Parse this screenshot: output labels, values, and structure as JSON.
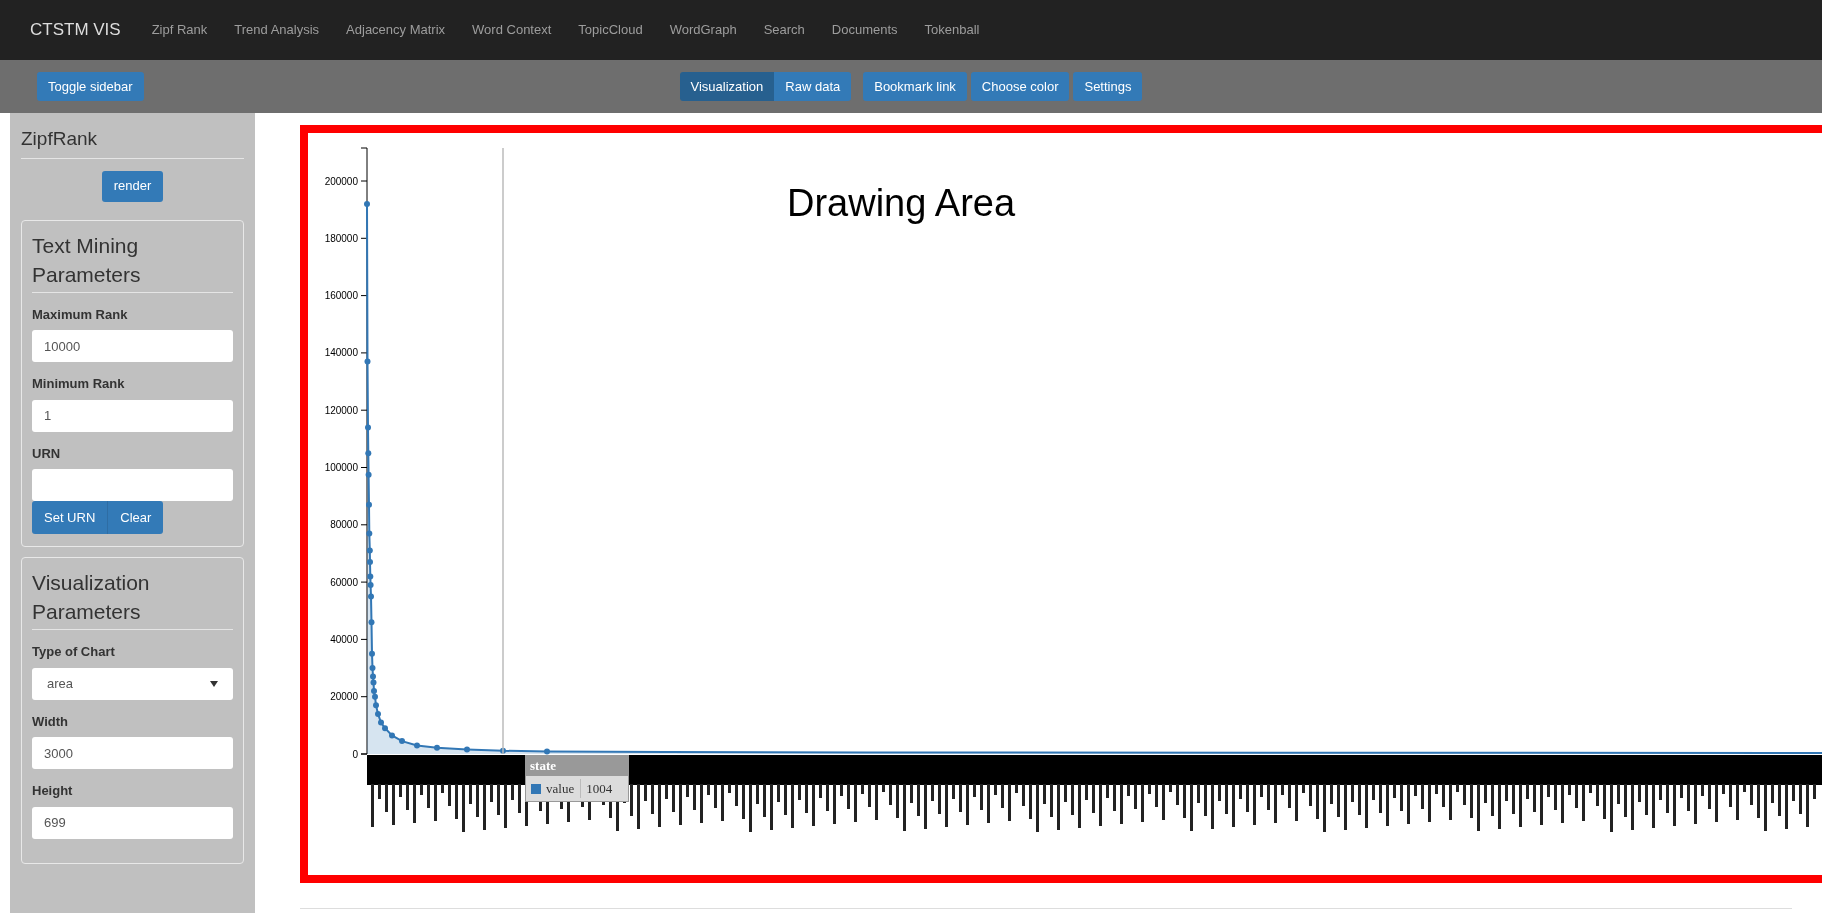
{
  "navbar": {
    "brand": "CTSTM VIS",
    "links": [
      "Zipf Rank",
      "Trend Analysis",
      "Adjacency Matrix",
      "Word Context",
      "TopicCloud",
      "WordGraph",
      "Search",
      "Documents",
      "Tokenball"
    ]
  },
  "toolbar": {
    "toggle": "Toggle sidebar",
    "view_tabs": [
      {
        "label": "Visualization",
        "selected": true
      },
      {
        "label": "Raw data",
        "selected": false
      }
    ],
    "buttons": [
      "Bookmark link",
      "Choose color",
      "Settings"
    ]
  },
  "sidebar": {
    "title": "ZipfRank",
    "render_button": "render",
    "panels": [
      {
        "title": "Text Mining Parameters",
        "fields": [
          {
            "kind": "input",
            "label": "Maximum Rank",
            "value": "10000"
          },
          {
            "kind": "input",
            "label": "Minimum Rank",
            "value": "1"
          },
          {
            "kind": "input",
            "label": "URN"
          }
        ],
        "buttons": [
          "Set URN",
          "Clear"
        ]
      },
      {
        "title": "Visualization Parameters",
        "fields": [
          {
            "kind": "select",
            "label": "Type of Chart",
            "value": "area"
          },
          {
            "kind": "input",
            "label": "Width",
            "value": "3000"
          },
          {
            "kind": "input",
            "label": "Height",
            "value": "699"
          }
        ]
      }
    ]
  },
  "drawing_area": {
    "label": "Drawing Area",
    "tooltip": {
      "title": "state",
      "series": "value",
      "value": "1004"
    },
    "y_axis_labels": [
      "200000",
      "180000",
      "160000",
      "140000",
      "120000",
      "100000",
      "80000",
      "60000",
      "40000",
      "20000",
      "0"
    ]
  }
}
